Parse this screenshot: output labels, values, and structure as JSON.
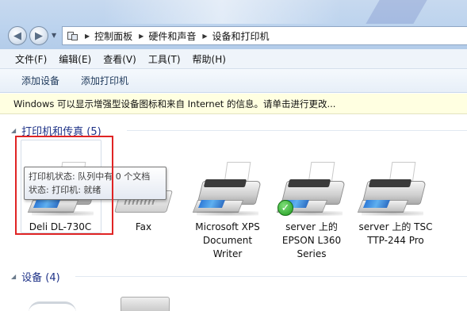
{
  "address": {
    "crumbs": [
      "控制面板",
      "硬件和声音",
      "设备和打印机"
    ]
  },
  "menu": [
    "文件(F)",
    "编辑(E)",
    "查看(V)",
    "工具(T)",
    "帮助(H)"
  ],
  "commands": [
    "添加设备",
    "添加打印机"
  ],
  "infobar_text": "Windows 可以显示增强型设备图标和来自 Internet 的信息。请单击进行更改...",
  "groups": {
    "printers": "打印机和传真 (5)",
    "devices": "设备 (4)"
  },
  "devices": [
    {
      "label": "Deli DL-730C",
      "icon": "printer-icon"
    },
    {
      "label": "Fax",
      "icon": "fax-icon"
    },
    {
      "label": "Microsoft XPS\nDocument\nWriter",
      "icon": "printer-icon"
    },
    {
      "label": "server 上的\nEPSON L360\nSeries",
      "icon": "printer-icon",
      "default": true
    },
    {
      "label": "server 上的 TSC\nTTP-244 Pro",
      "icon": "printer-icon"
    }
  ],
  "tooltip": {
    "line1": "打印机状态: 队列中有 0 个文档",
    "line2": "状态: 打印机: 就绪"
  },
  "colors": {
    "group_header": "#1e3287",
    "highlight": "#e02424",
    "infobar_bg": "#ffffe1"
  }
}
